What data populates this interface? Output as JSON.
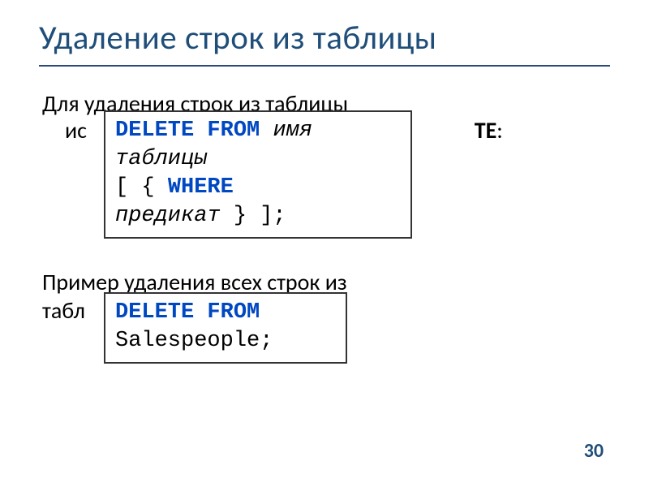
{
  "title": "Удаление строк из таблицы",
  "para1_line1": "Для удаления строк из таблицы",
  "para1_line2_start": "ис",
  "para1_line2_suffix_bold": "ТЕ",
  "para1_line2_colon": ":",
  "code1": {
    "kw1": "DELETE FROM",
    "id1": "имя",
    "id2": "таблицы",
    "lbracket": "[ {",
    "kw2": "WHERE",
    "id3": "предикат",
    "rbracket": "} ];"
  },
  "para2_line1": "Пример удаления всех строк из",
  "para2_line2_start": "табл",
  "code2": {
    "kw1": "DELETE FROM",
    "tbl": "Salespeople;"
  },
  "page_number": "30"
}
